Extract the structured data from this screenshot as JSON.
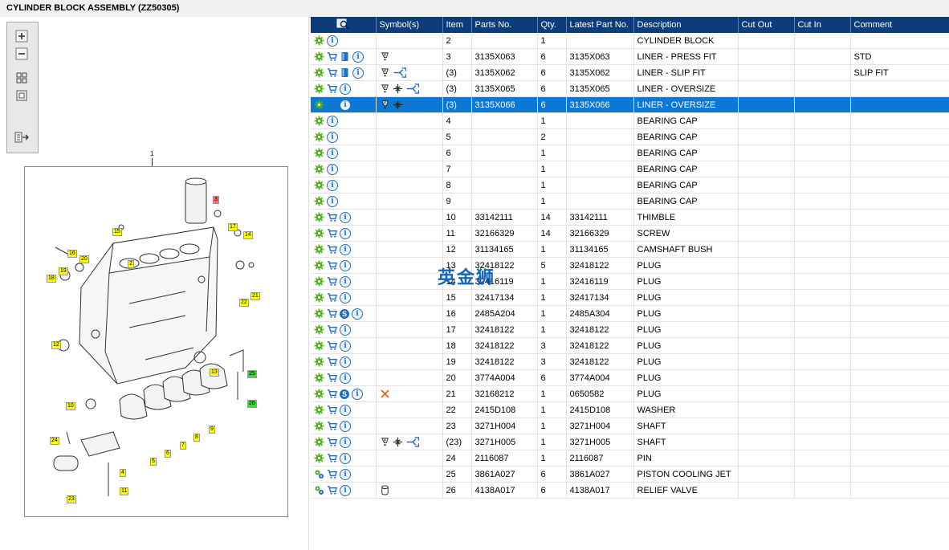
{
  "title": "CYLINDER BLOCK ASSEMBLY (ZZ50305)",
  "toolbar": {
    "icons": [
      "zoom-in-icon",
      "zoom-out-icon",
      "fit-all-icon",
      "fit-window-icon",
      "export-icon"
    ]
  },
  "diagram": {
    "top_label": "1",
    "callouts": [
      "3",
      "15",
      "17",
      "14",
      "16",
      "20",
      "2",
      "19",
      "18",
      "22",
      "21",
      "12",
      "13",
      "25",
      "10",
      "26",
      "24",
      "4",
      "11",
      "23",
      "5",
      "6",
      "7",
      "8",
      "9"
    ]
  },
  "watermark": "英金狮",
  "columns": [
    "Symbol(s)",
    "Item",
    "Parts No.",
    "Qty.",
    "Latest Part No.",
    "Description",
    "Cut Out",
    "Cut In",
    "Comment"
  ],
  "rows": [
    {
      "icons": "gi",
      "sym": "",
      "item": "2",
      "part": "",
      "qty": "1",
      "latest": "",
      "desc": "CYLINDER BLOCK",
      "comment": ""
    },
    {
      "icons": "gcbi",
      "sym": "w",
      "item": "3",
      "part": "3135X063",
      "qty": "6",
      "latest": "3135X063",
      "desc": "LINER - PRESS FIT",
      "comment": "STD"
    },
    {
      "icons": "gcbi",
      "sym": "wa",
      "item": "(3)",
      "part": "3135X062",
      "qty": "6",
      "latest": "3135X062",
      "desc": "LINER - SLIP FIT",
      "comment": "SLIP FIT"
    },
    {
      "icons": "gci",
      "sym": "wsa",
      "item": "(3)",
      "part": "3135X065",
      "qty": "6",
      "latest": "3135X065",
      "desc": "LINER - OVERSIZE",
      "comment": ""
    },
    {
      "icons": "gci",
      "sym": "wsa",
      "item": "(3)",
      "part": "3135X066",
      "qty": "6",
      "latest": "3135X066",
      "desc": "LINER - OVERSIZE",
      "comment": "",
      "selected": true
    },
    {
      "icons": "gi",
      "sym": "",
      "item": "4",
      "part": "",
      "qty": "1",
      "latest": "",
      "desc": "BEARING CAP",
      "comment": ""
    },
    {
      "icons": "gi",
      "sym": "",
      "item": "5",
      "part": "",
      "qty": "2",
      "latest": "",
      "desc": "BEARING CAP",
      "comment": ""
    },
    {
      "icons": "gi",
      "sym": "",
      "item": "6",
      "part": "",
      "qty": "1",
      "latest": "",
      "desc": "BEARING CAP",
      "comment": ""
    },
    {
      "icons": "gi",
      "sym": "",
      "item": "7",
      "part": "",
      "qty": "1",
      "latest": "",
      "desc": "BEARING CAP",
      "comment": ""
    },
    {
      "icons": "gi",
      "sym": "",
      "item": "8",
      "part": "",
      "qty": "1",
      "latest": "",
      "desc": "BEARING CAP",
      "comment": ""
    },
    {
      "icons": "gi",
      "sym": "",
      "item": "9",
      "part": "",
      "qty": "1",
      "latest": "",
      "desc": "BEARING CAP",
      "comment": ""
    },
    {
      "icons": "gci",
      "sym": "",
      "item": "10",
      "part": "33142111",
      "qty": "14",
      "latest": "33142111",
      "desc": "THIMBLE",
      "comment": ""
    },
    {
      "icons": "gci",
      "sym": "",
      "item": "11",
      "part": "32166329",
      "qty": "14",
      "latest": "32166329",
      "desc": "SCREW",
      "comment": ""
    },
    {
      "icons": "gci",
      "sym": "",
      "item": "12",
      "part": "31134165",
      "qty": "1",
      "latest": "31134165",
      "desc": "CAMSHAFT BUSH",
      "comment": ""
    },
    {
      "icons": "gci",
      "sym": "",
      "item": "13",
      "part": "32418122",
      "qty": "5",
      "latest": "32418122",
      "desc": "PLUG",
      "comment": ""
    },
    {
      "icons": "gci",
      "sym": "",
      "item": "14",
      "part": "32416119",
      "qty": "1",
      "latest": "32416119",
      "desc": "PLUG",
      "comment": ""
    },
    {
      "icons": "gci",
      "sym": "",
      "item": "15",
      "part": "32417134",
      "qty": "1",
      "latest": "32417134",
      "desc": "PLUG",
      "comment": ""
    },
    {
      "icons": "gcsi",
      "sym": "",
      "item": "16",
      "part": "2485A204",
      "qty": "1",
      "latest": "2485A304",
      "desc": "PLUG",
      "comment": ""
    },
    {
      "icons": "gci",
      "sym": "",
      "item": "17",
      "part": "32418122",
      "qty": "1",
      "latest": "32418122",
      "desc": "PLUG",
      "comment": ""
    },
    {
      "icons": "gci",
      "sym": "",
      "item": "18",
      "part": "32418122",
      "qty": "3",
      "latest": "32418122",
      "desc": "PLUG",
      "comment": ""
    },
    {
      "icons": "gci",
      "sym": "",
      "item": "19",
      "part": "32418122",
      "qty": "3",
      "latest": "32418122",
      "desc": "PLUG",
      "comment": ""
    },
    {
      "icons": "gci",
      "sym": "",
      "item": "20",
      "part": "3774A004",
      "qty": "6",
      "latest": "3774A004",
      "desc": "PLUG",
      "comment": ""
    },
    {
      "icons": "gcsi",
      "sym": "x",
      "item": "21",
      "part": "32168212",
      "qty": "1",
      "latest": "0650582",
      "desc": "PLUG",
      "comment": ""
    },
    {
      "icons": "gci",
      "sym": "",
      "item": "22",
      "part": "2415D108",
      "qty": "1",
      "latest": "2415D108",
      "desc": "WASHER",
      "comment": ""
    },
    {
      "icons": "gci",
      "sym": "",
      "item": "23",
      "part": "3271H004",
      "qty": "1",
      "latest": "3271H004",
      "desc": "SHAFT",
      "comment": ""
    },
    {
      "icons": "gci",
      "sym": "wsa",
      "item": "(23)",
      "part": "3271H005",
      "qty": "1",
      "latest": "3271H005",
      "desc": "SHAFT",
      "comment": ""
    },
    {
      "icons": "gci",
      "sym": "",
      "item": "24",
      "part": "2116087",
      "qty": "1",
      "latest": "2116087",
      "desc": "PIN",
      "comment": ""
    },
    {
      "icons": "Gci",
      "sym": "",
      "item": "25",
      "part": "3861A027",
      "qty": "6",
      "latest": "3861A027",
      "desc": "PISTON COOLING JET",
      "comment": ""
    },
    {
      "icons": "Gci",
      "sym": "c",
      "item": "26",
      "part": "4138A017",
      "qty": "6",
      "latest": "4138A017",
      "desc": "RELIEF VALVE",
      "comment": ""
    }
  ]
}
